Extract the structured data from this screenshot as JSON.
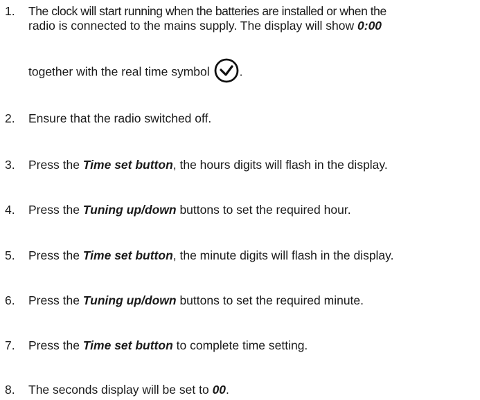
{
  "steps": [
    {
      "num": "1.",
      "line1": "The clock will start running when the batteries are installed or when the",
      "line2a": "radio is connected to the mains supply. The display will show ",
      "line2b": "0:00",
      "line3a": "together with the real time symbol",
      "line3b": ".",
      "icon": "real-time-clock-icon"
    },
    {
      "num": "2.",
      "a": "Ensure that the radio switched off.",
      "b": "",
      "c": ""
    },
    {
      "num": "3.",
      "a": "Press the ",
      "b": "Time set button",
      "c": ", the hours digits will flash in the display."
    },
    {
      "num": "4.",
      "a": "Press the ",
      "b": "Tuning up/down",
      "c": " buttons to set the required hour."
    },
    {
      "num": "5.",
      "a": "Press the ",
      "b": "Time set button",
      "c": ", the minute digits will flash in the display."
    },
    {
      "num": "6.",
      "a": "Press the ",
      "b": "Tuning up/down",
      "c": " buttons to set the required minute."
    },
    {
      "num": "7.",
      "a": "Press the ",
      "b": "Time set button",
      "c": " to complete time setting."
    },
    {
      "num": "8.",
      "a": "The seconds display will be set to ",
      "b": "00",
      "c": "."
    }
  ]
}
